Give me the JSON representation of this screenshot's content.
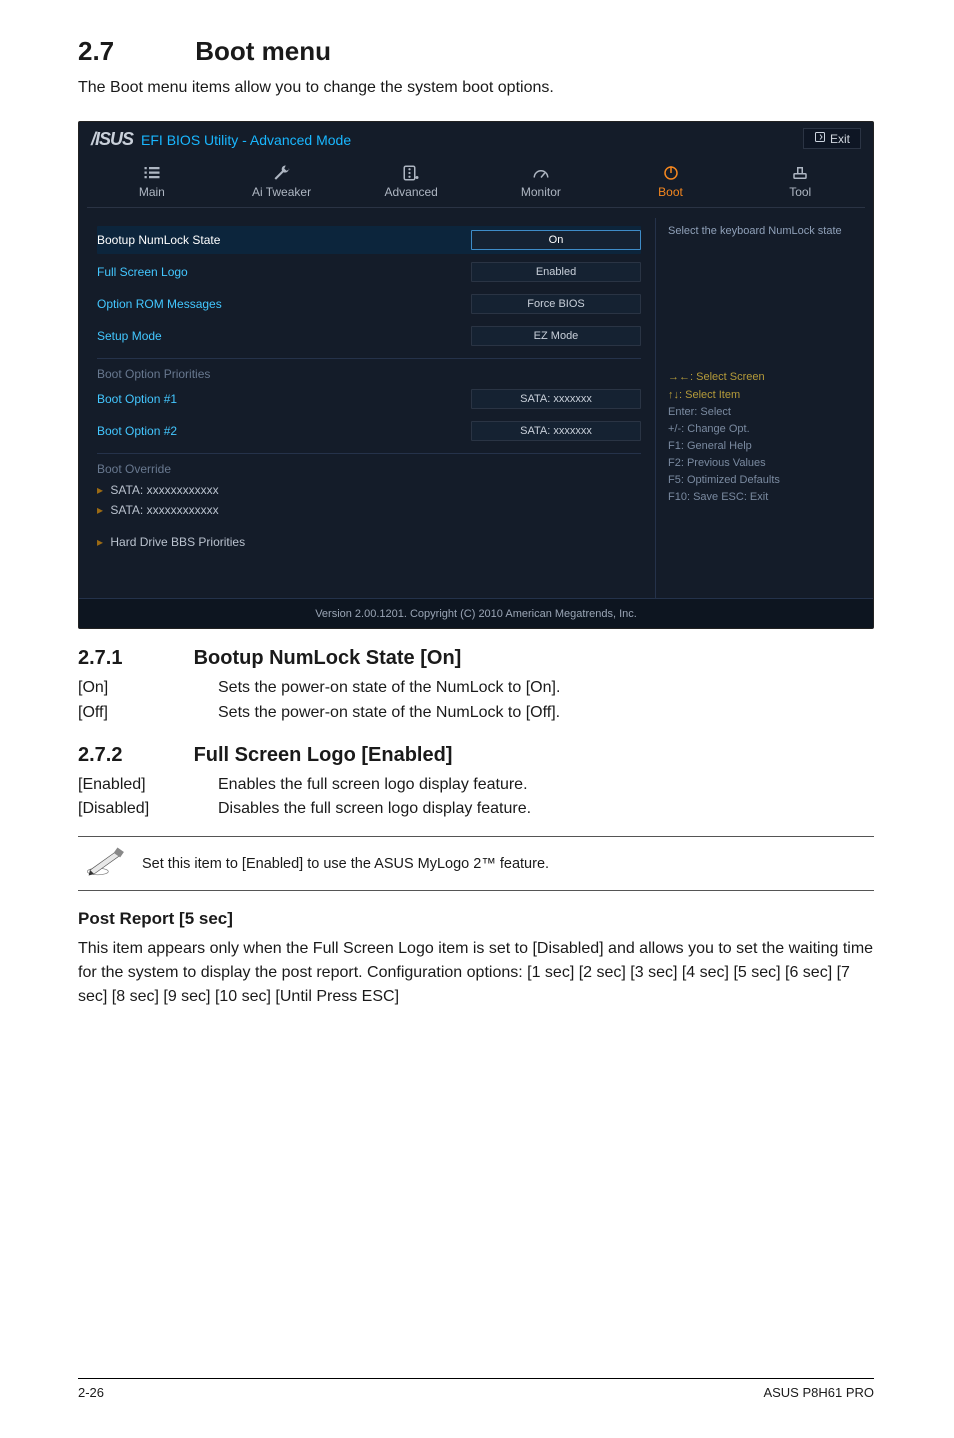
{
  "bios": {
    "logo_prefix": "/SUS",
    "top_title": "EFI BIOS Utility - Advanced Mode",
    "exit_label": "Exit",
    "tabs": {
      "main": "Main",
      "ai_tweaker": "Ai  Tweaker",
      "advanced": "Advanced",
      "monitor": "Monitor",
      "boot": "Boot",
      "tool": "Tool"
    },
    "settings": [
      {
        "label": "Bootup NumLock State",
        "value": "On",
        "highlight": true
      },
      {
        "label": "Full Screen Logo",
        "value": "Enabled",
        "highlight": false
      },
      {
        "label": "Option ROM Messages",
        "value": "Force BIOS",
        "highlight": false
      },
      {
        "label": "Setup Mode",
        "value": "EZ Mode",
        "highlight": false
      }
    ],
    "boot_priorities_head": "Boot Option Priorities",
    "boot_options": [
      {
        "label": "Boot Option #1",
        "value": "SATA: xxxxxxx"
      },
      {
        "label": "Boot Option #2",
        "value": "SATA: xxxxxxx"
      }
    ],
    "override_head": "Boot Override",
    "override_items": [
      "SATA: xxxxxxxxxxxx",
      "SATA: xxxxxxxxxxxx"
    ],
    "hard_drive_bbs": "Hard Drive BBS Priorities",
    "help_text": "Select the keyboard NumLock state",
    "keys": {
      "l1": "→←:  Select Screen",
      "l2": "↑↓:  Select Item",
      "l3": "Enter:  Select",
      "l4": "+/-:  Change Opt.",
      "l5": "F1:  General Help",
      "l6": "F2:  Previous Values",
      "l7": "F5:  Optimized Defaults",
      "l8": "F10:  Save   ESC:  Exit"
    },
    "footer": "Version  2.00.1201.   Copyright  (C)  2010 American  Megatrends,  Inc."
  },
  "doc": {
    "sec_num": "2.7",
    "sec_title": "Boot menu",
    "intro": "The Boot menu items allow you to change the system boot options.",
    "s271_num": "2.7.1",
    "s271_title": "Bootup NumLock State [On]",
    "s271_on_key": "[On]",
    "s271_on_txt": "Sets the power-on state of the NumLock to [On].",
    "s271_off_key": "[Off]",
    "s271_off_txt": "Sets the power-on state of the NumLock to [Off].",
    "s272_num": "2.7.2",
    "s272_title": "Full Screen Logo [Enabled]",
    "s272_en_key": "[Enabled]",
    "s272_en_txt": "Enables the full screen logo display feature.",
    "s272_dis_key": "[Disabled]",
    "s272_dis_txt": "Disables the full screen logo display feature.",
    "note": "Set this item to [Enabled] to use the ASUS MyLogo 2™ feature.",
    "postreport_head": "Post Report [5 sec]",
    "postreport_body": "This item appears only when the Full Screen Logo item is set to [Disabled] and allows you to set the waiting time for the system to display the post report. Configuration options: [1 sec] [2 sec] [3 sec] [4 sec] [5 sec] [6 sec] [7 sec] [8 sec] [9 sec] [10 sec] [Until Press ESC]",
    "page_num": "2-26",
    "product": "ASUS P8H61 PRO"
  }
}
